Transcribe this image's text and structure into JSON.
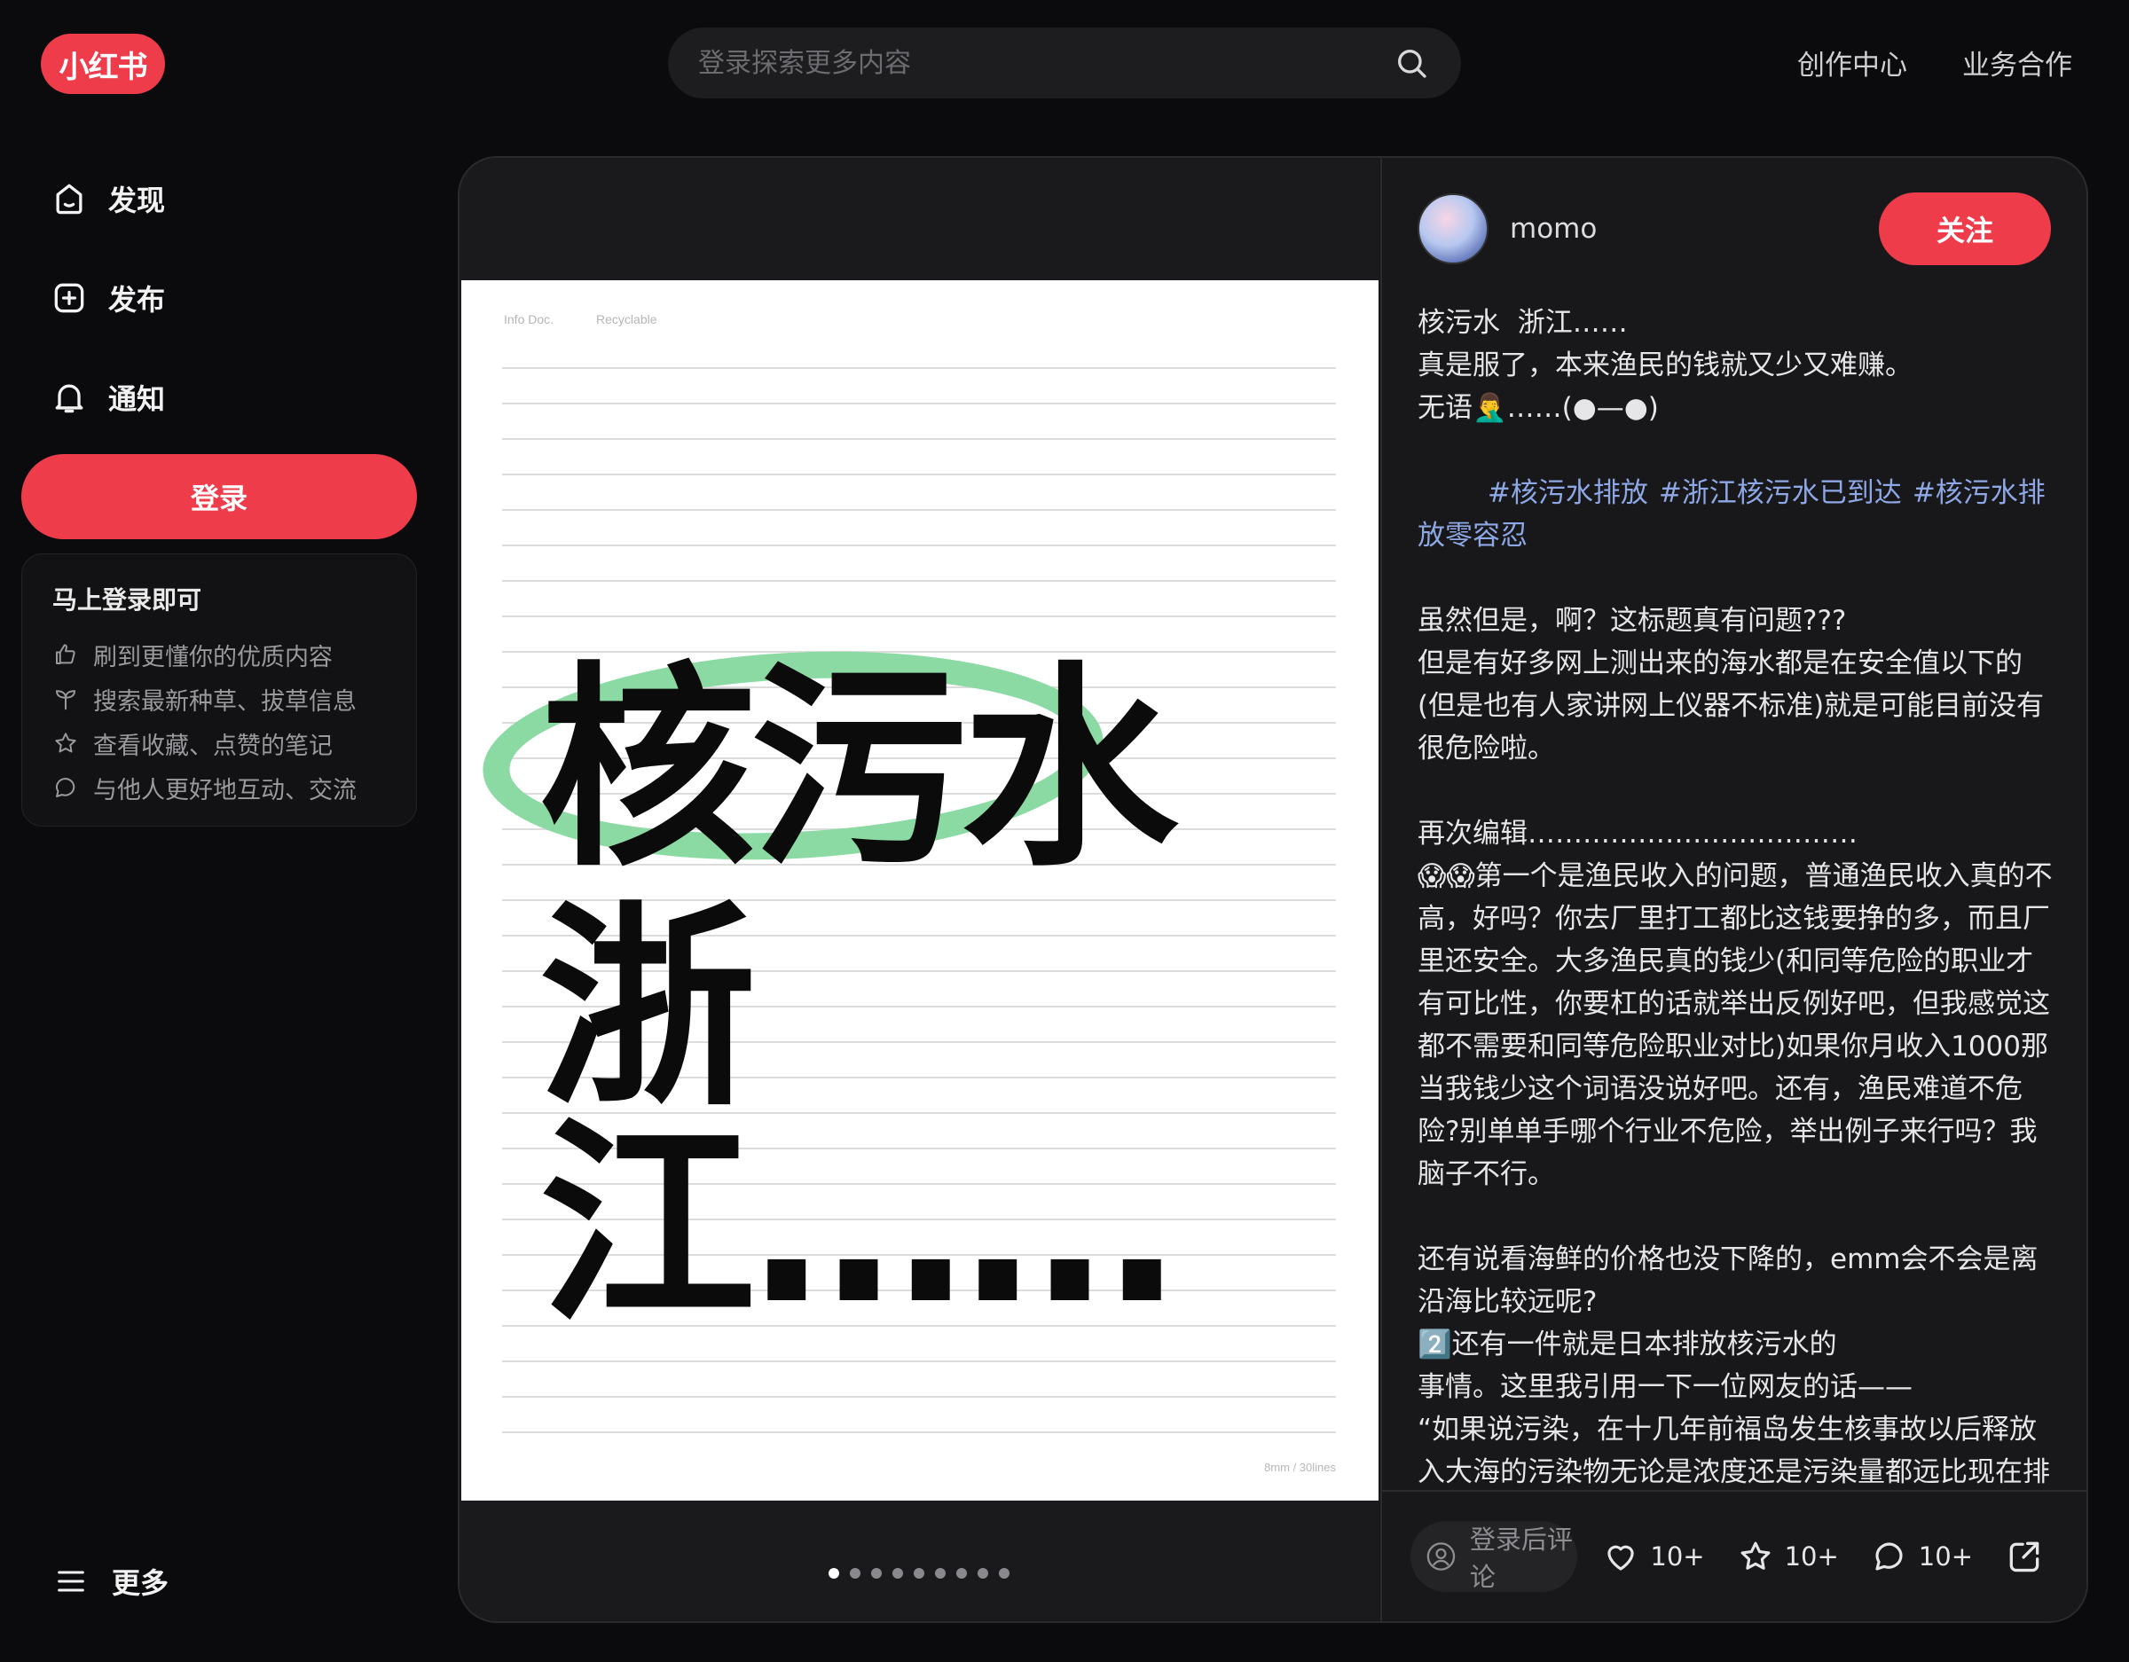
{
  "brand": {
    "logo_text": "小红书",
    "color": "#ee3c4b"
  },
  "search": {
    "placeholder": "登录探索更多内容"
  },
  "top_links": [
    "创作中心",
    "业务合作"
  ],
  "sidebar": {
    "items": [
      {
        "label": "发现",
        "icon": "home-icon"
      },
      {
        "label": "发布",
        "icon": "add-square-icon"
      },
      {
        "label": "通知",
        "icon": "bell-icon"
      }
    ],
    "login_label": "登录",
    "promo": {
      "title": "马上登录即可",
      "items": [
        {
          "label": "刷到更懂你的优质内容",
          "icon": "thumbs-up-icon"
        },
        {
          "label": "搜索最新种草、拔草信息",
          "icon": "sprout-icon"
        },
        {
          "label": "查看收藏、点赞的笔记",
          "icon": "star-icon"
        },
        {
          "label": "与他人更好地互动、交流",
          "icon": "chat-icon"
        }
      ]
    },
    "more_label": "更多"
  },
  "note": {
    "image": {
      "header_left": "Info Doc.",
      "header_right": "Recyclable",
      "footer": "8mm / 30lines",
      "line1": "核污水",
      "line2": "浙江……",
      "highlight_color": "#8bdaa4"
    },
    "carousel": {
      "count": 9,
      "active_index": 0
    },
    "author": {
      "name": "momo"
    },
    "follow_label": "关注",
    "content": {
      "p1": "核污水  浙江……\n真是服了，本来渔民的钱就又少又难赚。\n无语🤦‍♂️……(●—●)",
      "tags": [
        "#核污水排放",
        "#浙江核污水已到达",
        "#核污水排放零容忍"
      ],
      "p2": "虽然但是，啊？这标题真有问题???\n但是有好多网上测出来的海水都是在安全值以下的(但是也有人家讲网上仪器不标准)就是可能目前没有很危险啦。",
      "p3": "再次编辑………………………………\n😱😱第一个是渔民收入的问题，普通渔民收入真的不高，好吗？你去厂里打工都比这钱要挣的多，而且厂里还安全。大多渔民真的钱少(和同等危险的职业才有可比性，你要杠的话就举出反例好吧，但我感觉这都不需要和同等危险职业对比)如果你月收入1000那当我钱少这个词语没说好吧。还有，渔民难道不危险?别单单手哪个行业不危险，举出例子来行吗？我脑子不行。",
      "p4": "还有说看海鲜的价格也没下降的，emm会不会是离沿海比较远呢?\n2️⃣还有一件就是日本排放核污水的\n事情。这里我引用一下一位网友的话——\n“如果说污染，在十几年前福岛发生核事故以后释放入大海的污染物无论是浓度还是污染量都远比现在排污水多得多，当时我们没有大张旗鼓地批评日本，是因为那是天灾，属于不可抗力，换言之就是"
    },
    "engage": {
      "comment_placeholder": "登录后评论",
      "likes": "10+",
      "collects": "10+",
      "comments": "10+"
    }
  }
}
